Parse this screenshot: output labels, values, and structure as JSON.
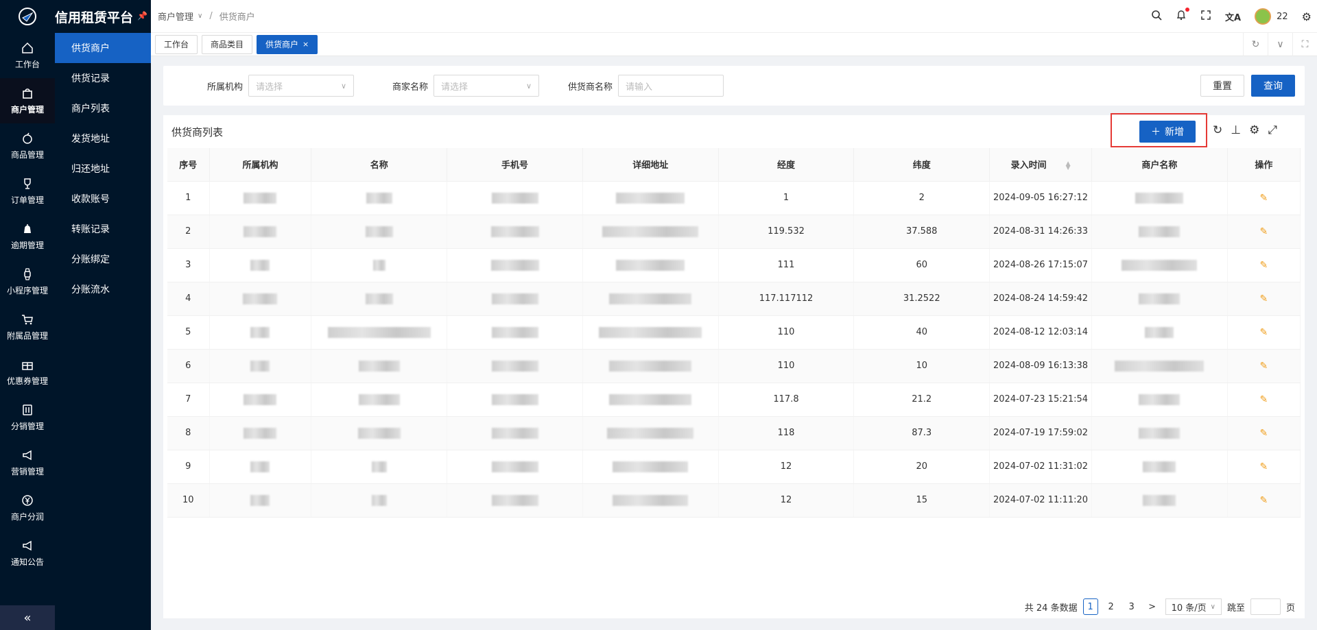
{
  "app": {
    "title": "信用租赁平台"
  },
  "rail": [
    {
      "label": "工作台",
      "icon": "home-icon"
    },
    {
      "label": "商户管理",
      "icon": "bag-icon",
      "active": true
    },
    {
      "label": "商品管理",
      "icon": "apple-icon"
    },
    {
      "label": "订单管理",
      "icon": "trophy-icon"
    },
    {
      "label": "逾期管理",
      "icon": "alarm-icon"
    },
    {
      "label": "小程序管理",
      "icon": "watch-icon"
    },
    {
      "label": "附属品管理",
      "icon": "cart-icon"
    },
    {
      "label": "优惠券管理",
      "icon": "gift-icon"
    },
    {
      "label": "分销管理",
      "icon": "sliders-icon"
    },
    {
      "label": "营销管理",
      "icon": "megaphone-icon"
    },
    {
      "label": "商户分润",
      "icon": "yen-icon"
    },
    {
      "label": "通知公告",
      "icon": "megaphone-icon"
    }
  ],
  "subnav": [
    "供货商户",
    "供货记录",
    "商户列表",
    "发货地址",
    "归还地址",
    "收款账号",
    "转账记录",
    "分账绑定",
    "分账流水"
  ],
  "header": {
    "breadcrumb": [
      "商户管理",
      "供货商户"
    ],
    "user": "22"
  },
  "tabs": [
    {
      "label": "工作台"
    },
    {
      "label": "商品类目"
    },
    {
      "label": "供货商户",
      "active": true
    }
  ],
  "filter": {
    "org_label": "所属机构",
    "org_placeholder": "请选择",
    "merchant_label": "商家名称",
    "merchant_placeholder": "请选择",
    "supplier_label": "供货商名称",
    "supplier_placeholder": "请输入",
    "reset": "重置",
    "search": "查询"
  },
  "list": {
    "title": "供货商列表",
    "add": "新增",
    "columns": [
      "序号",
      "所属机构",
      "名称",
      "手机号",
      "详细地址",
      "经度",
      "纬度",
      "录入时间",
      "商户名称",
      "操作"
    ],
    "rows": [
      {
        "no": "1",
        "lng": "1",
        "lat": "2",
        "time": "2024-09-05 16:27:12"
      },
      {
        "no": "2",
        "lng": "119.532",
        "lat": "37.588",
        "time": "2024-08-31 14:26:33"
      },
      {
        "no": "3",
        "lng": "111",
        "lat": "60",
        "time": "2024-08-26 17:15:07"
      },
      {
        "no": "4",
        "lng": "117.117112",
        "lat": "31.2522",
        "time": "2024-08-24 14:59:42"
      },
      {
        "no": "5",
        "lng": "110",
        "lat": "40",
        "time": "2024-08-12 12:03:14"
      },
      {
        "no": "6",
        "lng": "110",
        "lat": "10",
        "time": "2024-08-09 16:13:38"
      },
      {
        "no": "7",
        "lng": "117.8",
        "lat": "21.2",
        "time": "2024-07-23 15:21:54"
      },
      {
        "no": "8",
        "lng": "118",
        "lat": "87.3",
        "time": "2024-07-19 17:59:02"
      },
      {
        "no": "9",
        "lng": "12",
        "lat": "20",
        "time": "2024-07-02 11:31:02"
      },
      {
        "no": "10",
        "lng": "12",
        "lat": "15",
        "time": "2024-07-02 11:11:20"
      }
    ]
  },
  "pager": {
    "total": "共 24 条数据",
    "pages": [
      "1",
      "2",
      "3"
    ],
    "next": ">",
    "size": "10 条/页",
    "jump_label": "跳至",
    "page_unit": "页"
  },
  "colors": {
    "primary": "#1662c4",
    "sidebar": "#001529",
    "highlight": "#e53935"
  }
}
